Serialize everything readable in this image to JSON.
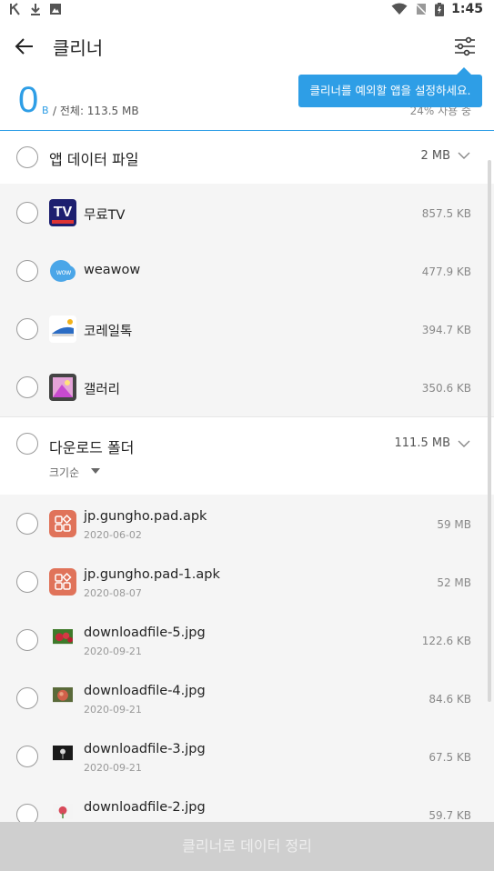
{
  "status_bar": {
    "time": "1:45",
    "left_icons": [
      "k-icon",
      "download-icon",
      "image-icon"
    ],
    "right_icons": [
      "wifi-icon",
      "no-sim-icon",
      "battery-icon"
    ]
  },
  "header": {
    "title": "클리너",
    "back_icon": "back-arrow-icon",
    "filter_icon": "filter-settings-icon"
  },
  "tooltip": {
    "text": "클리너를 예외할 앱을 설정하세요."
  },
  "summary": {
    "value": "0",
    "unit": "B",
    "total": "/ 전체: 113.5 MB",
    "usage": "24% 사용 중"
  },
  "app_data": {
    "label": "앱 데이터 파일",
    "size": "2 MB",
    "items": [
      {
        "name": "무료TV",
        "size": "857.5 KB",
        "icon": "tv-app-icon"
      },
      {
        "name": "weawow",
        "size": "477.9 KB",
        "icon": "weawow-icon"
      },
      {
        "name": "코레일톡",
        "size": "394.7 KB",
        "icon": "korail-icon"
      },
      {
        "name": "갤러리",
        "size": "350.6 KB",
        "icon": "gallery-icon"
      }
    ]
  },
  "downloads": {
    "label": "다운로드 폴더",
    "size": "111.5 MB",
    "sort_label": "크기순",
    "items": [
      {
        "name": "jp.gungho.pad.apk",
        "date": "2020-06-02",
        "size": "59 MB",
        "icon": "apk-icon"
      },
      {
        "name": "jp.gungho.pad-1.apk",
        "date": "2020-08-07",
        "size": "52 MB",
        "icon": "apk-icon"
      },
      {
        "name": "downloadfile-5.jpg",
        "date": "2020-09-21",
        "size": "122.6 KB",
        "icon": "strawberry-thumbnail"
      },
      {
        "name": "downloadfile-4.jpg",
        "date": "2020-09-21",
        "size": "84.6 KB",
        "icon": "apple-thumbnail"
      },
      {
        "name": "downloadfile-3.jpg",
        "date": "2020-09-21",
        "size": "67.5 KB",
        "icon": "dark-thumbnail"
      },
      {
        "name": "downloadfile-2.jpg",
        "date": "",
        "size": "59.7 KB",
        "icon": "flower-thumbnail"
      }
    ]
  },
  "action": {
    "label": "클리너로 데이터 정리"
  },
  "colors": {
    "accent": "#2e9ee6",
    "button_disabled": "#cfcfcf"
  }
}
